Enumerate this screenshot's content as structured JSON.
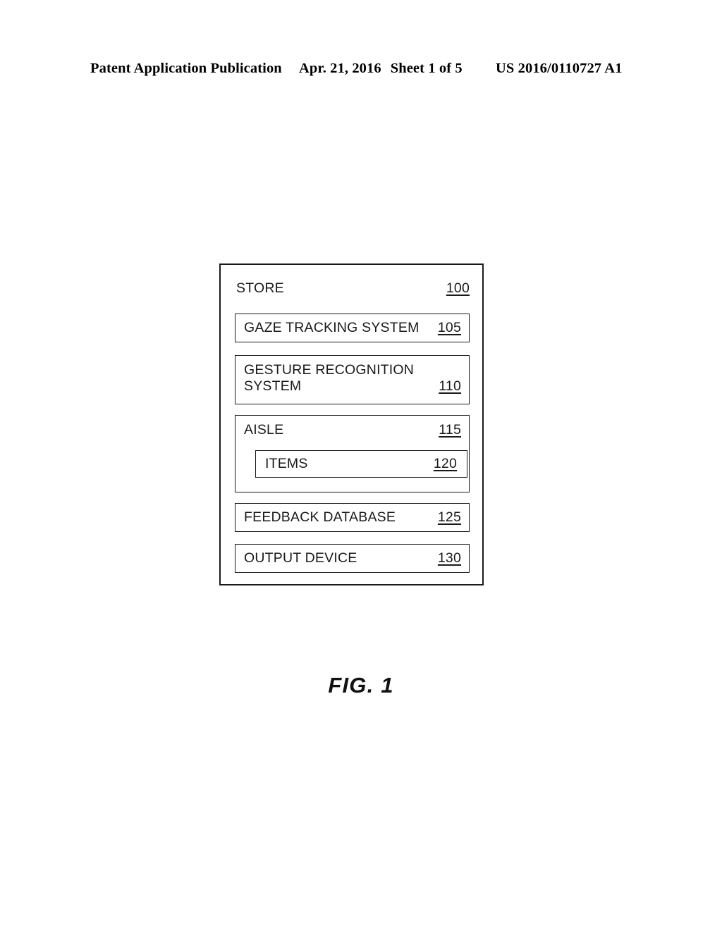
{
  "header": {
    "left": "Patent Application Publication",
    "date": "Apr. 21, 2016",
    "sheet": "Sheet 1 of 5",
    "publication_number": "US 2016/0110727 A1"
  },
  "figure": {
    "caption": "FIG. 1",
    "store": {
      "label": "STORE",
      "numeral": "100"
    },
    "modules": [
      {
        "label": "GAZE TRACKING SYSTEM",
        "numeral": "105"
      },
      {
        "label": "GESTURE RECOGNITION\nSYSTEM",
        "numeral": "110"
      },
      {
        "label": "AISLE",
        "numeral": "115"
      },
      {
        "label": "ITEMS",
        "numeral": "120"
      },
      {
        "label": "FEEDBACK DATABASE",
        "numeral": "125"
      },
      {
        "label": "OUTPUT DEVICE",
        "numeral": "130"
      }
    ]
  }
}
